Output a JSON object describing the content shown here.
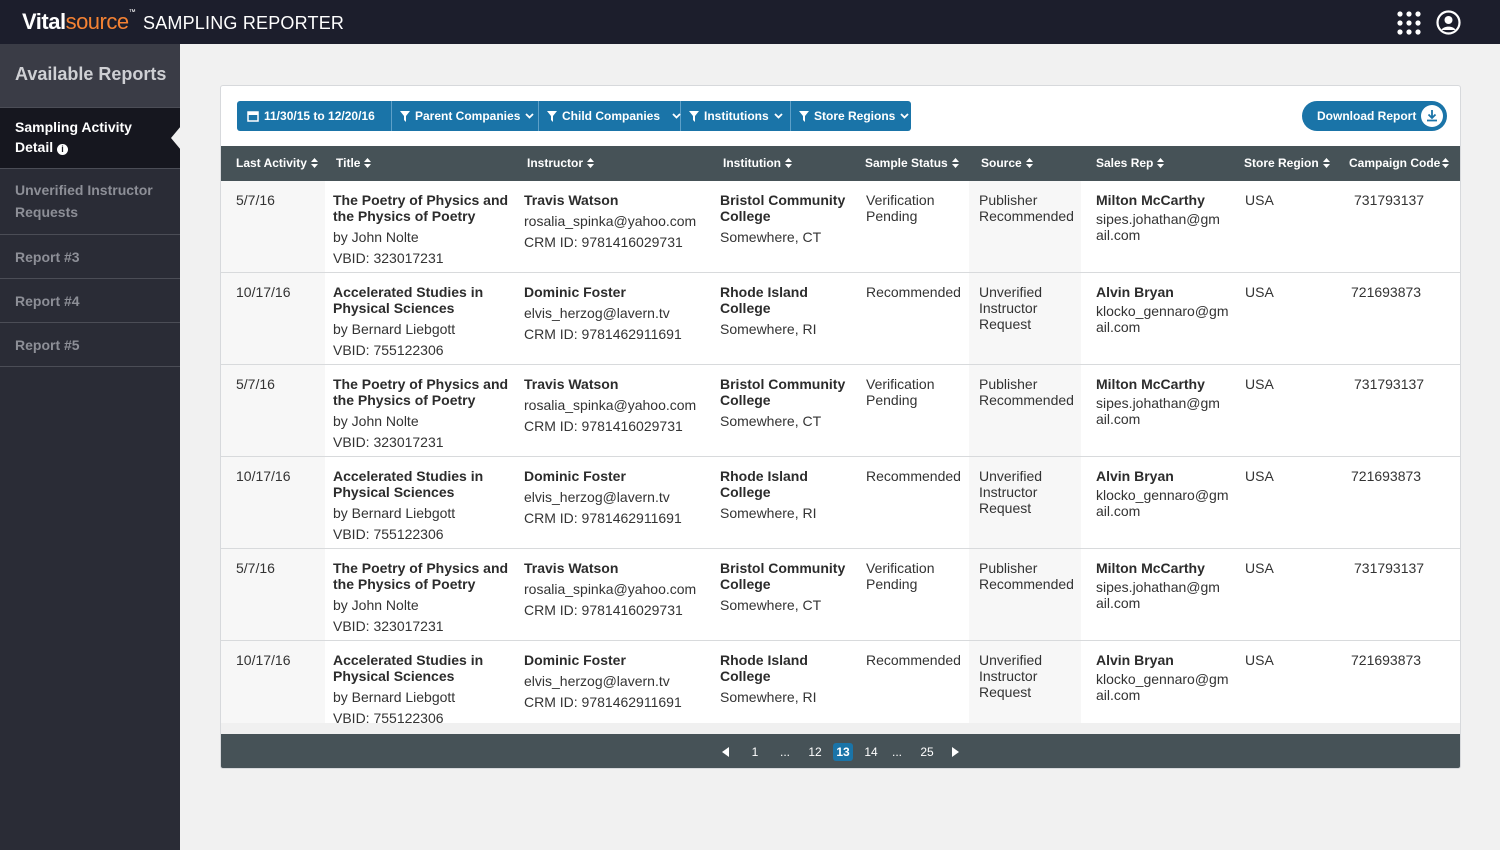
{
  "header": {
    "logo_bold": "Vital",
    "logo_light": "source",
    "logo_tm": "™",
    "app_name": "SAMPLING REPORTER"
  },
  "sidebar": {
    "title": "Available Reports",
    "items": [
      {
        "label_line1": "Sampling Activity",
        "label_line2": "Detail",
        "active": true
      },
      {
        "label_line1": "Unverified Instructor",
        "label_line2": "Requests"
      },
      {
        "label": "Report #3"
      },
      {
        "label": "Report #4"
      },
      {
        "label": "Report #5"
      }
    ]
  },
  "filters": {
    "date_range": "11/30/15 to 12/20/16",
    "parent_companies": "Parent Companies",
    "child_companies": "Child Companies",
    "institutions": "Institutions",
    "store_regions": "Store Regions"
  },
  "download_label": "Download Report",
  "columns": [
    "Last Activity",
    "Title",
    "Instructor",
    "Institution",
    "Sample Status",
    "Source",
    "Sales Rep",
    "Store Region",
    "Campaign Code"
  ],
  "rows": [
    {
      "date": "5/7/16",
      "title1": "The Poetry of Physics and",
      "title2": "the Physics of Poetry",
      "author": "by John Nolte",
      "vbid": "VBID:  323017231",
      "instructor": "Travis Watson",
      "email": "rosalia_spinka@yahoo.com",
      "crm": "CRM ID:  9781416029731",
      "inst1": "Bristol Community",
      "inst2": "College",
      "location": "Somewhere, CT",
      "status1": "Verification",
      "status2": "Pending",
      "source1": "Publisher",
      "source2": "Recommended",
      "source3": "",
      "rep": "Milton McCarthy",
      "rep_email1": "sipes.johathan@gm",
      "rep_email2": "ail.com",
      "region": "USA",
      "code": "731793137"
    },
    {
      "date": "10/17/16",
      "title1": "Accelerated Studies in",
      "title2": "Physical Sciences",
      "author": "by Bernard Liebgott",
      "vbid": "VBID:  755122306",
      "instructor": "Dominic Foster",
      "email": "elvis_herzog@lavern.tv",
      "crm": "CRM ID:  9781462911691",
      "inst1": "Rhode Island",
      "inst2": "College",
      "location": "Somewhere, RI",
      "status1": "Recommended",
      "status2": "",
      "source1": "Unverified",
      "source2": "Instructor",
      "source3": "Request",
      "rep": "Alvin Bryan",
      "rep_email1": "klocko_gennaro@gm",
      "rep_email2": "ail.com",
      "region": "USA",
      "code": "721693873"
    },
    {
      "date": "5/7/16",
      "title1": "The Poetry of Physics and",
      "title2": "the Physics of Poetry",
      "author": "by John Nolte",
      "vbid": "VBID:  323017231",
      "instructor": "Travis Watson",
      "email": "rosalia_spinka@yahoo.com",
      "crm": "CRM ID:  9781416029731",
      "inst1": "Bristol Community",
      "inst2": "College",
      "location": "Somewhere, CT",
      "status1": "Verification",
      "status2": "Pending",
      "source1": "Publisher",
      "source2": "Recommended",
      "source3": "",
      "rep": "Milton McCarthy",
      "rep_email1": "sipes.johathan@gm",
      "rep_email2": "ail.com",
      "region": "USA",
      "code": "731793137"
    },
    {
      "date": "10/17/16",
      "title1": "Accelerated Studies in",
      "title2": "Physical Sciences",
      "author": "by Bernard Liebgott",
      "vbid": "VBID:  755122306",
      "instructor": "Dominic Foster",
      "email": "elvis_herzog@lavern.tv",
      "crm": "CRM ID:  9781462911691",
      "inst1": "Rhode Island",
      "inst2": "College",
      "location": "Somewhere, RI",
      "status1": "Recommended",
      "status2": "",
      "source1": "Unverified",
      "source2": "Instructor",
      "source3": "Request",
      "rep": "Alvin Bryan",
      "rep_email1": "klocko_gennaro@gm",
      "rep_email2": "ail.com",
      "region": "USA",
      "code": "721693873"
    },
    {
      "date": "5/7/16",
      "title1": "The Poetry of Physics and",
      "title2": "the Physics of Poetry",
      "author": "by John Nolte",
      "vbid": "VBID:  323017231",
      "instructor": "Travis Watson",
      "email": "rosalia_spinka@yahoo.com",
      "crm": "CRM ID:  9781416029731",
      "inst1": "Bristol Community",
      "inst2": "College",
      "location": "Somewhere, CT",
      "status1": "Verification",
      "status2": "Pending",
      "source1": "Publisher",
      "source2": "Recommended",
      "source3": "",
      "rep": "Milton McCarthy",
      "rep_email1": "sipes.johathan@gm",
      "rep_email2": "ail.com",
      "region": "USA",
      "code": "731793137"
    },
    {
      "date": "10/17/16",
      "title1": "Accelerated Studies in",
      "title2": "Physical Sciences",
      "author": "by Bernard Liebgott",
      "vbid": "VBID:  755122306",
      "instructor": "Dominic Foster",
      "email": "elvis_herzog@lavern.tv",
      "crm": "CRM ID:  9781462911691",
      "inst1": "Rhode Island",
      "inst2": "College",
      "location": "Somewhere, RI",
      "status1": "Recommended",
      "status2": "",
      "source1": "Unverified",
      "source2": "Instructor",
      "source3": "Request",
      "rep": "Alvin Bryan",
      "rep_email1": "klocko_gennaro@gm",
      "rep_email2": "ail.com",
      "region": "USA",
      "code": "721693873"
    }
  ],
  "pagination": {
    "pages": [
      "1",
      "...",
      "12",
      "13",
      "14",
      "...",
      "25"
    ],
    "current": "13"
  },
  "colors": {
    "topbar": "#1c1e2c",
    "sidebar": "#2a2c36",
    "accent": "#1a74a8",
    "table_header": "#465257",
    "logo_orange": "#f58233"
  },
  "icons": [
    "calendar-icon",
    "filter-icon",
    "chevron-down-icon",
    "download-icon",
    "apps-grid-icon",
    "user-account-icon",
    "info-icon",
    "sort-icon"
  ]
}
